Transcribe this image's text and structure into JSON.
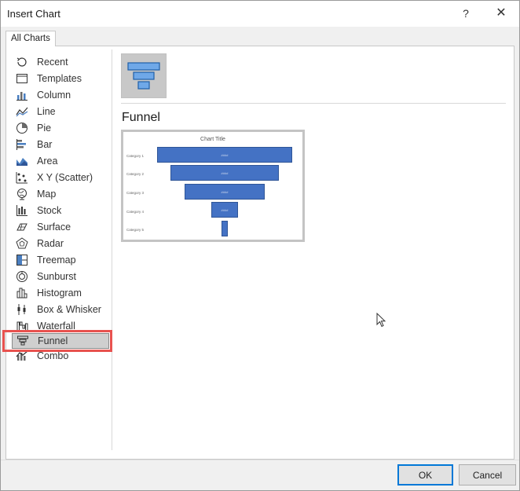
{
  "window": {
    "title": "Insert Chart",
    "help_label": "?",
    "close_label": "✕"
  },
  "tabs": [
    {
      "label": "All Charts",
      "active": true
    }
  ],
  "sidebar": {
    "items": [
      {
        "label": "Recent",
        "icon": "recent-icon"
      },
      {
        "label": "Templates",
        "icon": "templates-icon"
      },
      {
        "label": "Column",
        "icon": "column-chart-icon"
      },
      {
        "label": "Line",
        "icon": "line-chart-icon"
      },
      {
        "label": "Pie",
        "icon": "pie-chart-icon"
      },
      {
        "label": "Bar",
        "icon": "bar-chart-icon"
      },
      {
        "label": "Area",
        "icon": "area-chart-icon"
      },
      {
        "label": "X Y (Scatter)",
        "icon": "scatter-chart-icon"
      },
      {
        "label": "Map",
        "icon": "map-chart-icon"
      },
      {
        "label": "Stock",
        "icon": "stock-chart-icon"
      },
      {
        "label": "Surface",
        "icon": "surface-chart-icon"
      },
      {
        "label": "Radar",
        "icon": "radar-chart-icon"
      },
      {
        "label": "Treemap",
        "icon": "treemap-chart-icon"
      },
      {
        "label": "Sunburst",
        "icon": "sunburst-chart-icon"
      },
      {
        "label": "Histogram",
        "icon": "histogram-chart-icon"
      },
      {
        "label": "Box & Whisker",
        "icon": "box-whisker-chart-icon"
      },
      {
        "label": "Waterfall",
        "icon": "waterfall-chart-icon"
      },
      {
        "label": "Funnel",
        "icon": "funnel-chart-icon",
        "selected": true
      },
      {
        "label": "Combo",
        "icon": "combo-chart-icon"
      }
    ]
  },
  "main": {
    "chart_type_name": "Funnel",
    "thumbnail_icon": "funnel-chart-icon"
  },
  "preview": {
    "title": "Chart Title",
    "categories": [
      "Category 1",
      "Category 2",
      "Category 3",
      "Category 4",
      "Category 5"
    ],
    "value_label": "####",
    "bar_color": "#4472c4"
  },
  "buttons": {
    "ok_label": "OK",
    "cancel_label": "Cancel"
  },
  "colors": {
    "highlight": "#e8524f",
    "accent": "#0078d7"
  }
}
